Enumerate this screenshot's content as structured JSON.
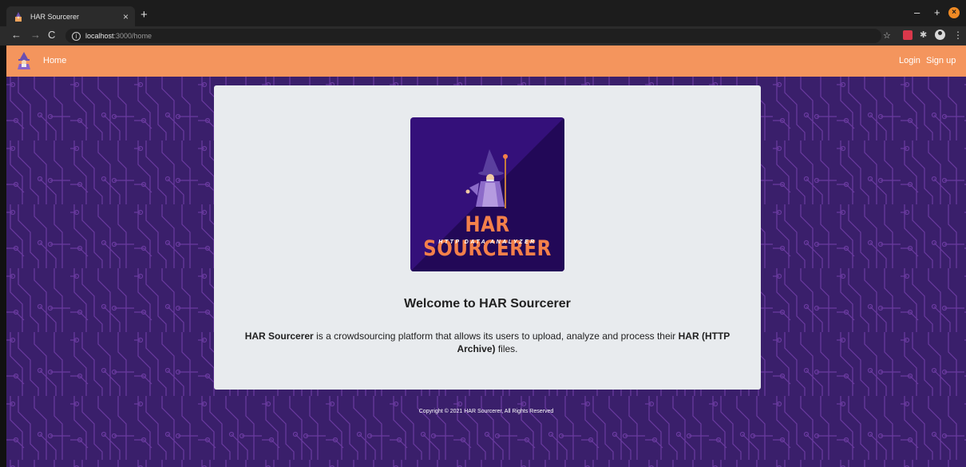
{
  "browser": {
    "tab_title": "HAR Sourcerer",
    "tab_close": "×",
    "new_tab": "+",
    "url_host": "localhost",
    "url_path": ":3000/home",
    "info_glyph": "i",
    "min_glyph": "–",
    "max_glyph": "+",
    "close_glyph": "×",
    "back_glyph": "←",
    "fwd_glyph": "→",
    "reload_glyph": "C",
    "star_glyph": "☆",
    "puzzle_glyph": "✱",
    "menu_glyph": "⋮"
  },
  "navbar": {
    "home_label": "Home",
    "login_label": "Login",
    "signup_label": "Sign up"
  },
  "hero": {
    "logo_title": "HAR SOURCERER",
    "logo_subtitle": "HTTP DATA ANALYZER",
    "welcome": "Welcome to HAR Sourcerer",
    "desc_brand": "HAR Sourcerer",
    "desc_middle": " is a crowdsourcing platform that allows its users to upload, analyze and process their ",
    "desc_format": "HAR (HTTP Archive)",
    "desc_end": " files."
  },
  "footer": {
    "copyright": "Copyright © 2021 HAR Sourcerer, All Rights Reserved"
  },
  "icons": {
    "favicon": "wizard-icon",
    "nav_logo": "wizard-icon",
    "back": "arrow-left-icon",
    "forward": "arrow-right-icon",
    "reload": "reload-icon",
    "info": "info-icon",
    "bookmark": "star-icon",
    "extension": "puzzle-icon",
    "profile": "account-icon",
    "menu": "kebab-menu-icon"
  },
  "colors": {
    "navbar": "#f4955d",
    "background": "#3a1f6b",
    "circuit": "#6a3aa0",
    "card": "#e8ebee",
    "logo_bg": "#2a0c5c",
    "logo_text": "#f4804a"
  }
}
